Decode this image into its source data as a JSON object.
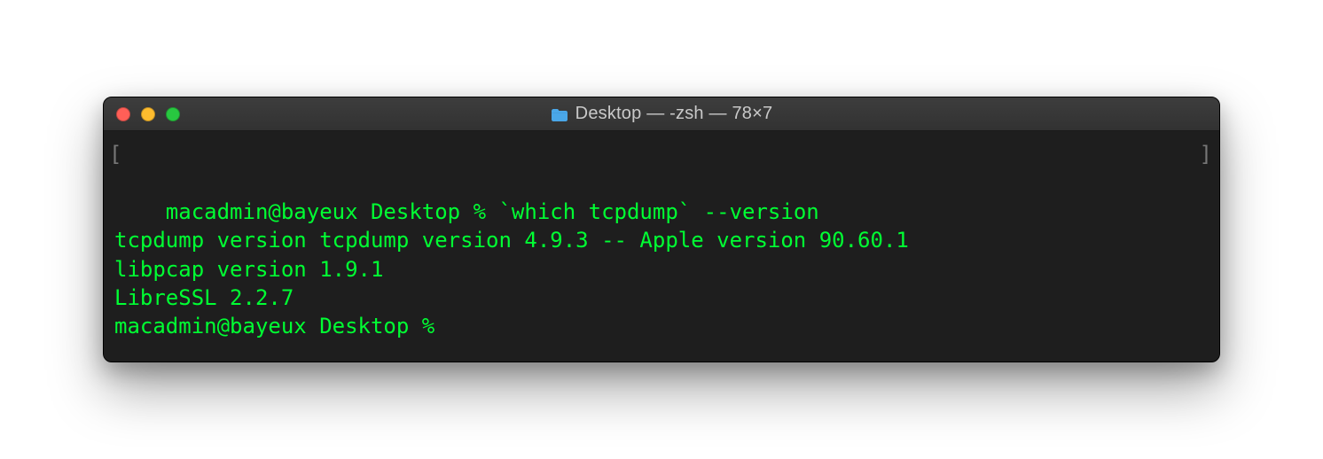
{
  "window": {
    "title": "Desktop — -zsh — 78×7"
  },
  "terminal": {
    "bracket_left": "[",
    "bracket_right": "]",
    "lines": {
      "l0_prompt": "macadmin@bayeux Desktop % ",
      "l0_cmd": "`which tcpdump` --version",
      "l1": "tcpdump version tcpdump version 4.9.3 -- Apple version 90.60.1",
      "l2": "libpcap version 1.9.1",
      "l3": "LibreSSL 2.2.7",
      "l4_prompt": "macadmin@bayeux Desktop % "
    }
  },
  "icons": {
    "folder": "folder-icon",
    "close": "close-icon",
    "minimize": "minimize-icon",
    "zoom": "zoom-icon"
  }
}
